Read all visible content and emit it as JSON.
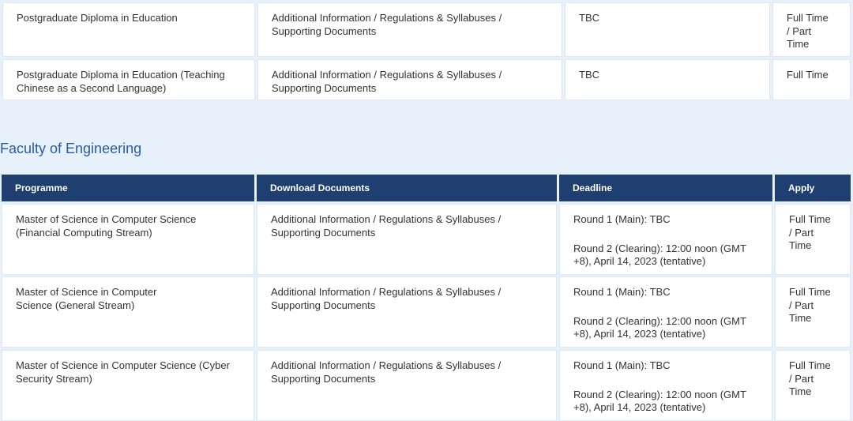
{
  "top_table": {
    "rows": [
      {
        "programme": "Postgraduate Diploma in Education",
        "docs": [
          "Additional Information / Regulations & Syllabuses /",
          "Supporting Documents"
        ],
        "deadline": "TBC",
        "apply": [
          "Full Time",
          "/ Part",
          "Time"
        ]
      },
      {
        "programme": [
          "Postgraduate Diploma in Education (Teaching",
          "Chinese as a Second Language)"
        ],
        "docs": [
          "Additional Information / Regulations & Syllabuses /",
          "Supporting Documents"
        ],
        "deadline": "TBC",
        "apply": [
          "Full Time"
        ]
      }
    ]
  },
  "engineering": {
    "title": "Faculty of Engineering",
    "headers": {
      "programme": "Programme",
      "docs": "Download Documents",
      "deadline": "Deadline",
      "apply": "Apply"
    },
    "rows": [
      {
        "programme": [
          "Master of Science in Computer Science",
          "(Financial Computing Stream)"
        ],
        "docs": [
          "Additional Information / Regulations & Syllabuses /",
          "Supporting Documents"
        ],
        "round1": "Round 1 (Main): TBC",
        "round2": [
          "Round 2 (Clearing): 12:00 noon (GMT",
          "+8), April 14, 2023 (tentative)"
        ],
        "apply": [
          "Full Time",
          "/ Part",
          "Time"
        ]
      },
      {
        "programme": [
          "Master of Science in Computer",
          "Science (General Stream)"
        ],
        "docs": [
          "Additional Information / Regulations & Syllabuses /",
          "Supporting Documents"
        ],
        "round1": "Round 1 (Main): TBC",
        "round2": [
          "Round 2 (Clearing): 12:00 noon (GMT",
          "+8), April 14, 2023 (tentative)"
        ],
        "apply": [
          "Full Time",
          "/ Part",
          "Time"
        ]
      },
      {
        "programme": [
          "Master of Science in Computer Science (Cyber",
          "Security Stream)"
        ],
        "docs": [
          "Additional Information / Regulations & Syllabuses /",
          "Supporting Documents"
        ],
        "round1": "Round 1 (Main): TBC",
        "round2": [
          "Round 2 (Clearing): 12:00 noon (GMT",
          "+8), April 14, 2023 (tentative)"
        ],
        "apply": [
          "Full Time",
          "/ Part",
          "Time"
        ]
      }
    ]
  }
}
